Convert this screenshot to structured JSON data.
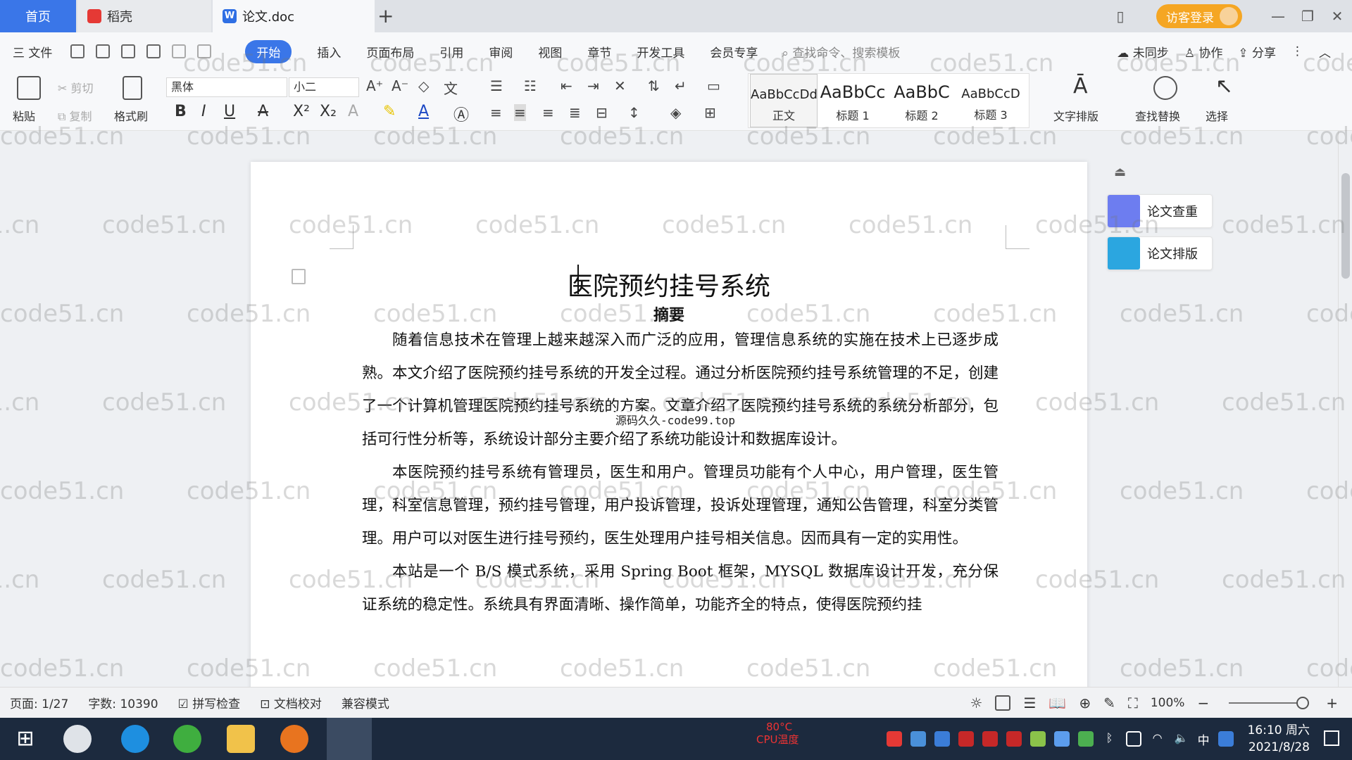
{
  "tabs": {
    "home": "首页",
    "daoke": "稻壳",
    "document": "论文.doc",
    "add": "+"
  },
  "window": {
    "login": "访客登录",
    "minimize": "—",
    "restore": "❐",
    "close": "✕"
  },
  "menu": {
    "file": "三 文件",
    "items": [
      "开始",
      "插入",
      "页面布局",
      "引用",
      "审阅",
      "视图",
      "章节",
      "开发工具",
      "会员专享"
    ],
    "active": "开始",
    "search_placeholder": "查找命令、搜索模板",
    "sync": "未同步",
    "collab": "协作",
    "share": "分享"
  },
  "ribbon": {
    "paste": "粘贴",
    "cut": "剪切",
    "copy": "复制",
    "format_painter": "格式刷",
    "font_name": "黑体",
    "font_size": "小二",
    "styles": [
      {
        "sample": "AaBbCcDd",
        "name": "正文"
      },
      {
        "sample": "AaBbCc",
        "name": "标题 1"
      },
      {
        "sample": "AaBbC",
        "name": "标题 2"
      },
      {
        "sample": "AaBbCcD",
        "name": "标题 3"
      }
    ],
    "text_layout": "文字排版",
    "find_replace": "查找替换",
    "select": "选择"
  },
  "document": {
    "title": "医院预约挂号系统",
    "subtitle": "摘要",
    "overlay": "源码久久-code99.top",
    "paragraphs": [
      "随着信息技术在管理上越来越深入而广泛的应用，管理信息系统的实施在技术上已逐步成熟。本文介绍了医院预约挂号系统的开发全过程。通过分析医院预约挂号系统管理的不足，创建了一个计算机管理医院预约挂号系统的方案。文章介绍了医院预约挂号系统的系统分析部分，包括可行性分析等，系统设计部分主要介绍了系统功能设计和数据库设计。",
      "本医院预约挂号系统有管理员，医生和用户。管理员功能有个人中心，用户管理，医生管理，科室信息管理，预约挂号管理，用户投诉管理，投诉处理管理，通知公告管理，科室分类管理。用户可以对医生进行挂号预约，医生处理用户挂号相关信息。因而具有一定的实用性。",
      "本站是一个 B/S 模式系统，采用 Spring Boot 框架，MYSQL 数据库设计开发，充分保证系统的稳定性。系统具有界面清晰、操作简单，功能齐全的特点，使得医院预约挂"
    ]
  },
  "side_panel": {
    "check": "论文查重",
    "layout": "论文排版"
  },
  "watermark": "code51.cn",
  "status": {
    "page": "页面: 1/27",
    "words": "字数: 10390",
    "spell": "拼写检查",
    "proof": "文档校对",
    "compat": "兼容模式",
    "zoom": "100%"
  },
  "taskbar": {
    "cpu_temp": "80°C",
    "cpu_label": "CPU温度",
    "ime": "中",
    "time": "16:10 周六",
    "date": "2021/8/28"
  },
  "colors": {
    "accent": "#3a76e8",
    "login": "#f5a623",
    "taskbar": "#1c2a3e"
  }
}
